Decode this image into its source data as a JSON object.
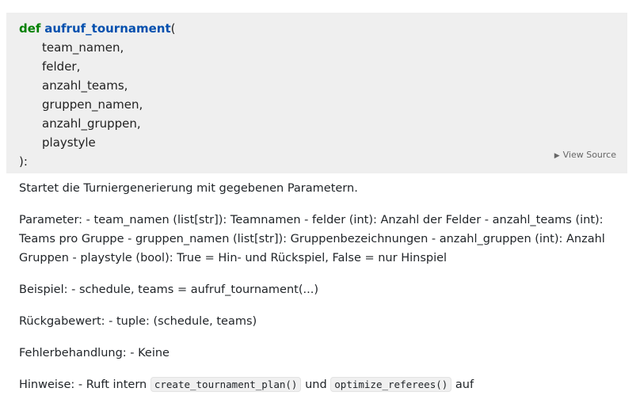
{
  "signature": {
    "keyword": "def",
    "function_name": "aufruf_tournament",
    "open_paren": "(",
    "params": [
      "team_namen,",
      "felder,",
      "anzahl_teams,",
      "gruppen_namen,",
      "anzahl_gruppen,",
      "playstyle"
    ],
    "close": "):",
    "view_source_label": "View Source",
    "view_source_icon": "triangle-right-icon"
  },
  "docstring": {
    "summary": "Startet die Turniergenerierung mit gegebenen Parametern.",
    "parameters": "Parameter: - team_namen (list[str]): Teamnamen - felder (int): Anzahl der Felder - anzahl_teams (int): Teams pro Gruppe - gruppen_namen (list[str]): Gruppenbezeichnungen - anzahl_gruppen (int): Anzahl Gruppen - playstyle (bool): True = Hin- und Rückspiel, False = nur Hinspiel",
    "example": "Beispiel: - schedule, teams = aufruf_tournament(...)",
    "returns": "Rückgabewert: - tuple: (schedule, teams)",
    "errors": "Fehlerbehandlung: - Keine",
    "notes": {
      "prefix": "Hinweise: - Ruft intern ",
      "code1": "create_tournament_plan()",
      "middle": " und ",
      "code2": "optimize_referees()",
      "suffix": " auf"
    }
  }
}
